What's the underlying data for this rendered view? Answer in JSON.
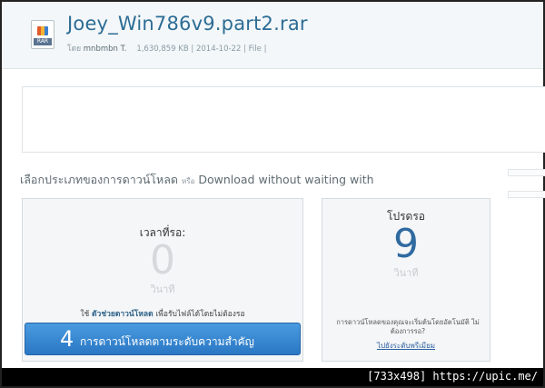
{
  "file": {
    "title": "Joey_Win786v9.part2.rar",
    "icon_ext": "RAR",
    "by_label": "โดย",
    "user": "mnbmbn T.",
    "size": "1,630,859 KB",
    "date": "2014-10-22",
    "type": "File"
  },
  "choose": {
    "text": "เลือกประเภทของการดาวน์โหลด",
    "or": "หรือ",
    "english": "Download without waiting with"
  },
  "free": {
    "wait_label": "เวลาที่รอ:",
    "wait_value": "0",
    "unit": "วินาที",
    "use_prefix": "ใช้",
    "use_bold": "ตัวช่วยดาวน์โหลด",
    "use_suffix": "เพื่อรับไฟล์ได้โดยไม่ต้องรอ",
    "button_number": "4",
    "button_label": "การดาวน์โหลดตามระดับความสำคัญ"
  },
  "premium": {
    "label": "โปรดรอ",
    "value": "9",
    "unit": "วินาที",
    "desc": "การดาวน์โหลดของคุณจะเริ่มต้นโดยอัตโนมัติ ไม่ต้องการรอ?",
    "link": "ไปยังระดับพรีเมียม"
  },
  "watermark": "[733x498] https://upic.me/",
  "colors": {
    "title": "#2d6c95",
    "button": "#2a77c4",
    "countdown": "#2f6aa0"
  }
}
